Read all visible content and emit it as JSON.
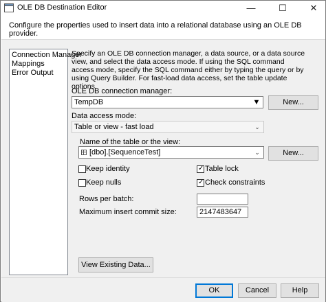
{
  "window": {
    "title": "OLE DB Destination Editor",
    "controls": {
      "minimize": "—",
      "maximize": "☐",
      "close": "✕"
    }
  },
  "intro": "Configure the properties used to insert data into a relational database using an OLE DB provider.",
  "nav": {
    "items": [
      {
        "label": "Connection Manager"
      },
      {
        "label": "Mappings"
      },
      {
        "label": "Error Output"
      }
    ]
  },
  "description": "Specify an OLE DB connection manager, a data source, or a data source view, and select the data access mode. If using the SQL command access mode, specify the SQL command either by typing the query or by using Query Builder. For fast-load data access, set the table update options.",
  "connection": {
    "label": "OLE DB connection manager:",
    "value": "TempDB",
    "new_button": "New..."
  },
  "access_mode": {
    "label": "Data access mode:",
    "value": "Table or view - fast load"
  },
  "table": {
    "label": "Name of the table or the view:",
    "value": "[dbo].[SequenceTest]",
    "new_button": "New..."
  },
  "options": {
    "keep_identity": {
      "label": "Keep identity",
      "checked": false
    },
    "keep_nulls": {
      "label": "Keep nulls",
      "checked": false
    },
    "table_lock": {
      "label": "Table lock",
      "checked": true
    },
    "check_constraints": {
      "label": "Check constraints",
      "checked": true
    }
  },
  "rows_per_batch": {
    "label": "Rows per batch:",
    "value": ""
  },
  "max_commit": {
    "label": "Maximum insert commit size:",
    "value": "2147483647"
  },
  "view_button": "View Existing Data...",
  "footer": {
    "ok": "OK",
    "cancel": "Cancel",
    "help": "Help"
  },
  "colors": {
    "accent": "#0078d7",
    "panel": "#f0f0f0"
  },
  "icons": {
    "app": "dialog-app-icon",
    "table": "table-icon"
  }
}
